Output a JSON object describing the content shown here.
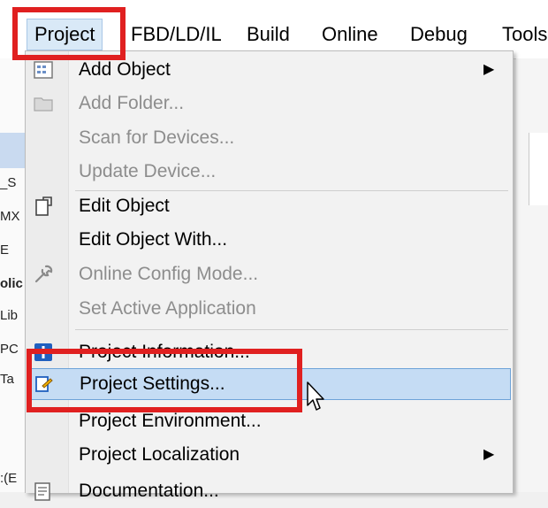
{
  "menubar": {
    "items": [
      {
        "label": "Project"
      },
      {
        "label": "FBD/LD/IL"
      },
      {
        "label": "Build"
      },
      {
        "label": "Online"
      },
      {
        "label": "Debug"
      },
      {
        "label": "Tools"
      }
    ]
  },
  "background": {
    "left_fragments": [
      "_S",
      "MX",
      "E",
      "olic",
      "Lib",
      "PC",
      "Ta",
      ":(E"
    ]
  },
  "project_menu": {
    "items": [
      {
        "label": "Add Object",
        "enabled": true,
        "submenu": true,
        "icon": "add-object-icon"
      },
      {
        "label": "Add Folder...",
        "enabled": false,
        "icon": "folder-icon"
      },
      {
        "label": "Scan for Devices...",
        "enabled": false
      },
      {
        "label": "Update Device...",
        "enabled": false
      },
      {
        "label": "Edit Object",
        "enabled": true,
        "icon": "edit-object-icon"
      },
      {
        "label": "Edit Object With...",
        "enabled": true
      },
      {
        "label": "Online Config Mode...",
        "enabled": false,
        "icon": "wrench-icon"
      },
      {
        "label": "Set Active Application",
        "enabled": false
      },
      {
        "label": "Project Information...",
        "enabled": true,
        "icon": "info-icon"
      },
      {
        "label": "Project Settings...",
        "enabled": true,
        "highlighted": true,
        "icon": "project-settings-icon"
      },
      {
        "label": "Project Environment...",
        "enabled": true
      },
      {
        "label": "Project Localization",
        "enabled": true,
        "submenu": true
      },
      {
        "label": "Documentation...",
        "enabled": true,
        "icon": "documentation-icon"
      }
    ]
  },
  "colors": {
    "highlight": "#c5dcf4",
    "highlight_border": "#6ea3d8",
    "callout": "#e02020",
    "disabled_text": "#8d8d8d"
  }
}
